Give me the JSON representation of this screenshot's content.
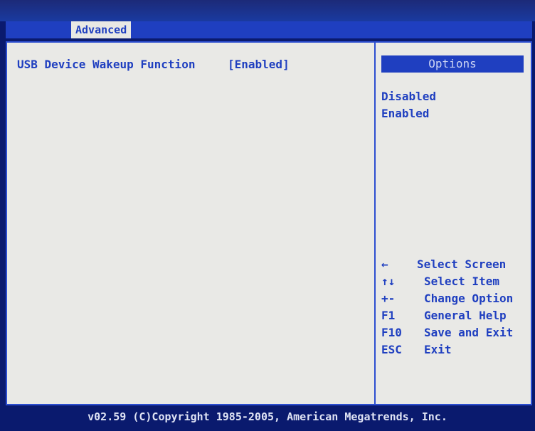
{
  "tabs": [
    {
      "label": "Advanced"
    }
  ],
  "settings": [
    {
      "label": "USB Device Wakeup Function",
      "value": "[Enabled]"
    }
  ],
  "options_panel": {
    "title": "Options",
    "items": [
      "Disabled",
      "Enabled"
    ]
  },
  "help": [
    {
      "key": "←",
      "desc": "Select Screen"
    },
    {
      "key": "↑↓",
      "desc": "Select Item"
    },
    {
      "key": "+-",
      "desc": "Change Option"
    },
    {
      "key": "F1",
      "desc": "General Help"
    },
    {
      "key": "F10",
      "desc": "Save and Exit"
    },
    {
      "key": "ESC",
      "desc": "Exit"
    }
  ],
  "footer": "v02.59 (C)Copyright 1985-2005, American Megatrends, Inc."
}
